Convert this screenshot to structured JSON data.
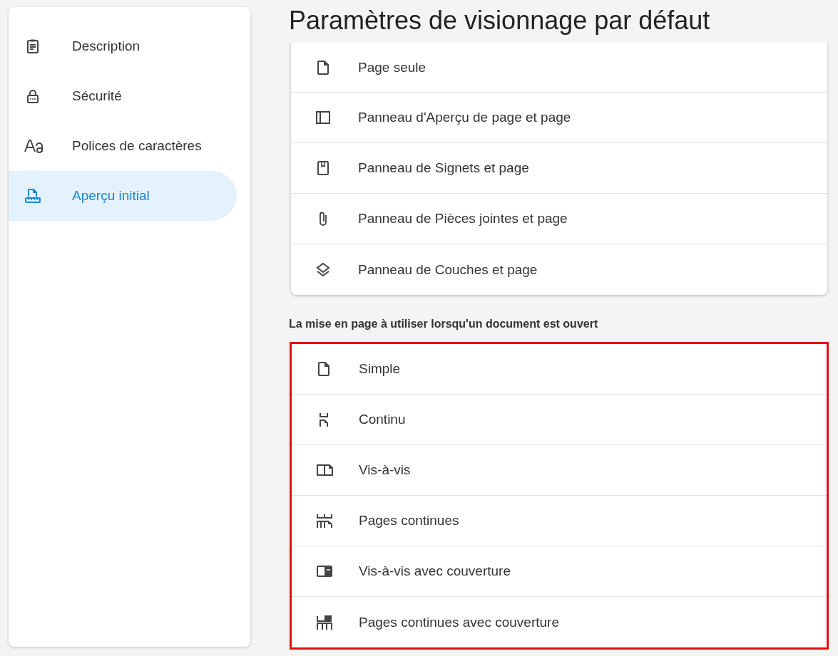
{
  "sidebar": {
    "items": [
      {
        "label": "Description",
        "kind": "clipboard",
        "selected": false
      },
      {
        "label": "Sécurité",
        "kind": "lock",
        "selected": false
      },
      {
        "label": "Polices de caractères",
        "kind": "font",
        "selected": false
      },
      {
        "label": "Aperçu initial",
        "kind": "page-ruler",
        "selected": true
      }
    ]
  },
  "title": "Paramètres de visionnage par défaut",
  "panel_options": [
    {
      "label": "Page seule",
      "kind": "page"
    },
    {
      "label": "Panneau d'Aperçu de page et page",
      "kind": "sidebar"
    },
    {
      "label": "Panneau de Signets et page",
      "kind": "bookmark"
    },
    {
      "label": "Panneau de Pièces jointes et page",
      "kind": "clip"
    },
    {
      "label": "Panneau de Couches et page",
      "kind": "layers"
    }
  ],
  "layout_section": {
    "heading": "La mise en page à utiliser lorsqu'un document est ouvert",
    "highlighted": true,
    "options": [
      {
        "label": "Simple",
        "kind": "page"
      },
      {
        "label": "Continu",
        "kind": "continuous"
      },
      {
        "label": "Vis-à-vis",
        "kind": "facing"
      },
      {
        "label": "Pages continues",
        "kind": "continuous-facing"
      },
      {
        "label": "Vis-à-vis avec couverture",
        "kind": "facing-cover"
      },
      {
        "label": "Pages continues avec couverture",
        "kind": "continuous-cover"
      }
    ]
  }
}
